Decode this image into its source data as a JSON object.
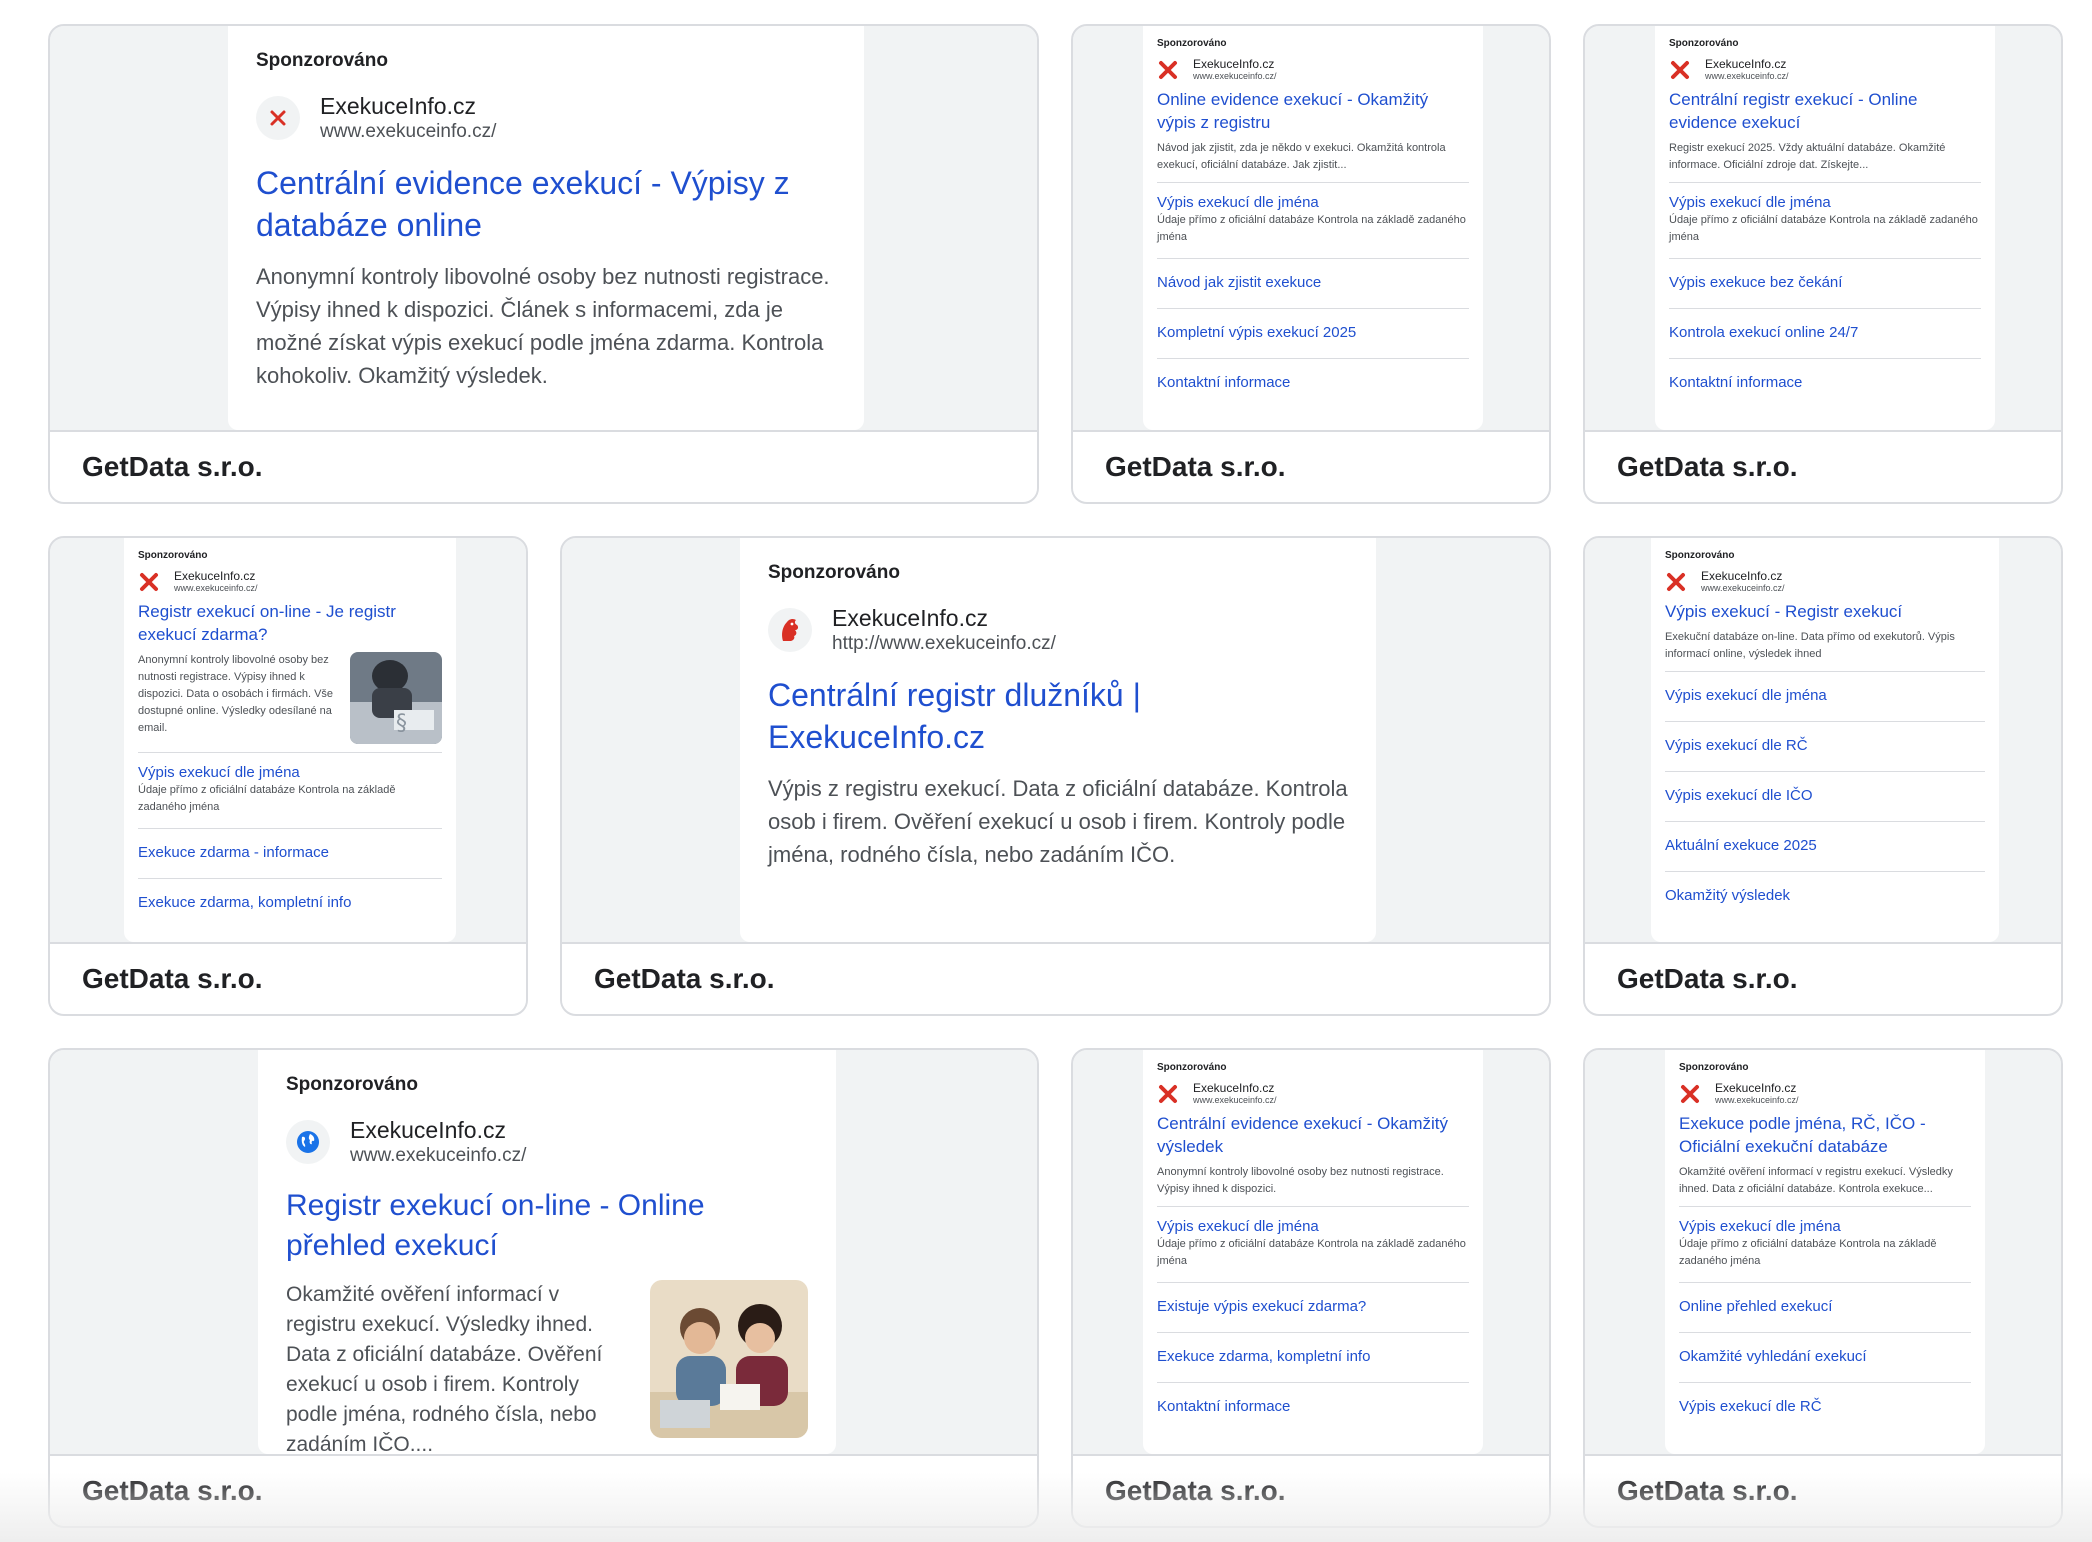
{
  "common": {
    "sponsored": "Sponzorováno",
    "footer_label": "GetData s.r.o.",
    "site_name": "ExekuceInfo.cz",
    "site_url": "www.exekuceinfo.cz/",
    "site_url_http": "http://www.exekuceinfo.cz/"
  },
  "colors": {
    "link": "#1f4fcf",
    "favicon_red": "#d93025",
    "favicon_blue": "#1a73e8"
  },
  "ads": {
    "ad1": {
      "title": "Centrální evidence exekucí - Výpisy z databáze online",
      "description": "Anonymní kontroly libovolné osoby bez nutnosti registrace. Výpisy ihned k dispozici. Článek s informacemi, zda je možné získat výpis exekucí podle jména zdarma. Kontrola kohokoliv. Okamžitý výsledek.",
      "icon": "x-mark-icon"
    },
    "ad2": {
      "title": "Online evidence exekucí - Okamžitý výpis z registru",
      "description": "Návod jak zjistit, zda je někdo v exekuci. Okamžitá kontrola exekucí, oficiální databáze. Jak zjistit...",
      "links": [
        {
          "title": "Výpis exekucí dle jména",
          "sub": "Údaje přímo z oficiální databáze Kontrola na základě zadaného jména"
        },
        {
          "title": "Návod jak zjistit exekuce"
        },
        {
          "title": "Kompletní výpis exekucí 2025"
        },
        {
          "title": "Kontaktní informace"
        }
      ]
    },
    "ad3": {
      "title": "Centrální registr exekucí - Online evidence exekucí",
      "description": "Registr exekucí 2025. Vždy aktuální databáze. Okamžité informace. Oficiální zdroje dat. Získejte...",
      "links": [
        {
          "title": "Výpis exekucí dle jména",
          "sub": "Údaje přímo z oficiální databáze Kontrola na základě zadaného jména"
        },
        {
          "title": "Výpis exekuce bez čekání"
        },
        {
          "title": "Kontrola exekucí online 24/7"
        },
        {
          "title": "Kontaktní informace"
        }
      ]
    },
    "ad4": {
      "title": "Registr exekucí on-line - Je registr exekucí zdarma?",
      "description": "Anonymní kontroly libovolné osoby bez nutnosti registrace. Výpisy ihned k dispozici. Data o osobách i firmách. Vše dostupné online. Výsledky odesílané na email.",
      "links": [
        {
          "title": "Výpis exekucí dle jména",
          "sub": "Údaje přímo z oficiální databáze Kontrola na základě zadaného jména"
        },
        {
          "title": "Exekuce zdarma - informace"
        },
        {
          "title": "Exekuce zdarma, kompletní info"
        }
      ]
    },
    "ad5": {
      "title": "Centrální registr dlužníků | ExekuceInfo.cz",
      "description": "Výpis z registru exekucí. Data z oficiální databáze. Kontrola osob i firem. Ověření exekucí u osob i firem. Kontroly podle jména, rodného čísla, nebo zadáním IČO.",
      "icon": "lion-crest-icon"
    },
    "ad6": {
      "title": "Výpis exekucí - Registr exekucí",
      "description": "Exekuční databáze on-line. Data přímo od exekutorů. Výpis informací online, výsledek ihned",
      "links": [
        {
          "title": "Výpis exekucí dle jména"
        },
        {
          "title": "Výpis exekucí dle RČ"
        },
        {
          "title": "Výpis exekucí dle IČO"
        },
        {
          "title": "Aktuální exekuce 2025"
        },
        {
          "title": "Okamžitý výsledek"
        }
      ]
    },
    "ad7": {
      "title": "Registr exekucí on-line - Online přehled exekucí",
      "description": "Okamžité ověření informací v registru exekucí. Výsledky ihned. Data z oficiální databáze. Ověření exekucí u osob i firem. Kontroly podle jména, rodného čísla, nebo zadáním IČO....",
      "icon": "globe-icon"
    },
    "ad8": {
      "title": "Centrální evidence exekucí - Okamžitý výsledek",
      "description": "Anonymní kontroly libovolné osoby bez nutnosti registrace. Výpisy ihned k dispozici.",
      "links": [
        {
          "title": "Výpis exekucí dle jména",
          "sub": "Údaje přímo z oficiální databáze Kontrola na základě zadaného jména"
        },
        {
          "title": "Existuje výpis exekucí zdarma?"
        },
        {
          "title": "Exekuce zdarma, kompletní info"
        },
        {
          "title": "Kontaktní informace"
        }
      ]
    },
    "ad9": {
      "title": "Exekuce podle jména, RČ, IČO - Oficiální exekuční databáze",
      "description": "Okamžité ověření informací v registru exekucí. Výsledky ihned. Data z oficiální databáze. Kontrola exekuce...",
      "links": [
        {
          "title": "Výpis exekucí dle jména",
          "sub": "Údaje přímo z oficiální databáze Kontrola na základě zadaného jména"
        },
        {
          "title": "Online přehled exekucí"
        },
        {
          "title": "Okamžité vyhledání exekucí"
        },
        {
          "title": "Výpis exekucí dle RČ"
        }
      ]
    }
  }
}
